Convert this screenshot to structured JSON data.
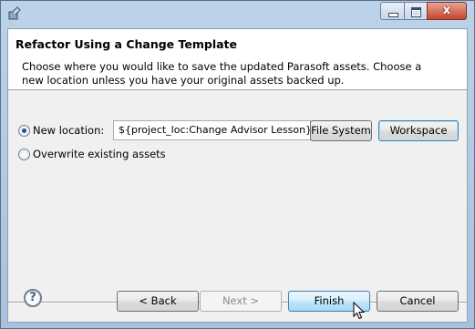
{
  "dialog": {
    "title": "Refactor Using a Change Template",
    "message_line1": "Choose where you would like to save the updated Parasoft assets.  Choose a",
    "message_line2": "new location unless you have your original assets backed up."
  },
  "options": {
    "new_location_label": "New location:",
    "new_location_value": "${project_loc:Change Advisor Lesson}",
    "overwrite_label": "Overwrite existing assets",
    "selected": "new_location"
  },
  "buttons": {
    "file_system": "File System",
    "workspace": "Workspace",
    "back": "< Back",
    "next": "Next >",
    "finish": "Finish",
    "cancel": "Cancel",
    "help": "?"
  },
  "window_controls": {
    "close": "x"
  }
}
